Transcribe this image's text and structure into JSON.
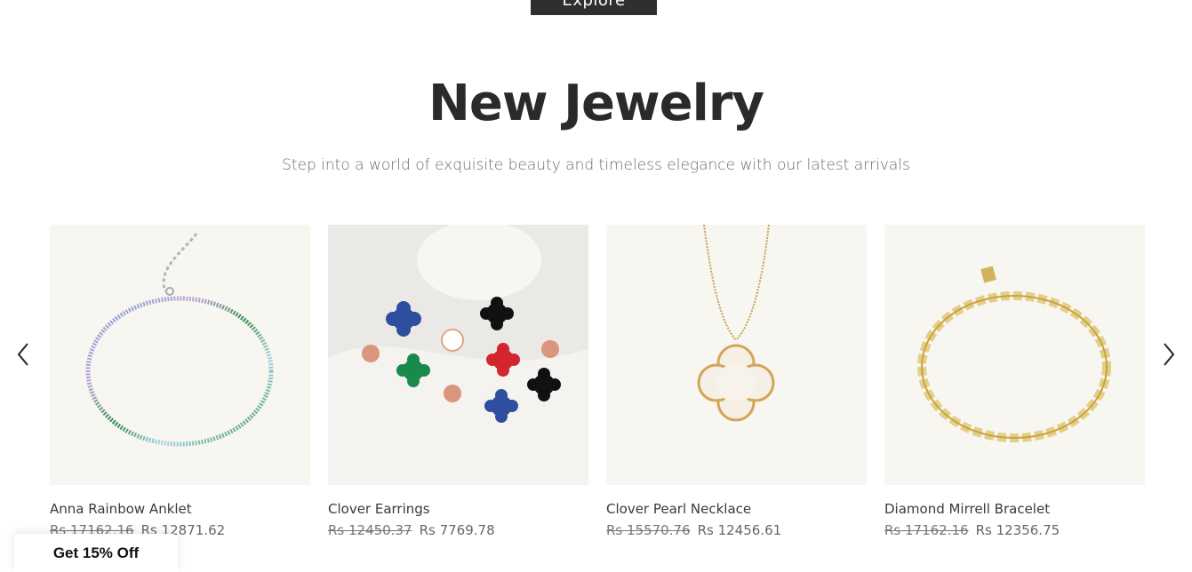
{
  "hero": {
    "explore_label": "Explore"
  },
  "section": {
    "title": "New Jewelry",
    "subtitle": "Step into a world of exquisite beauty and timeless elegance with our latest arrivals"
  },
  "carousel": {
    "prev_icon": "chevron-left-icon",
    "next_icon": "chevron-right-icon",
    "products": [
      {
        "name": "Anna Rainbow Anklet",
        "old_price": "Rs 17162.16",
        "new_price": "Rs 12871.62"
      },
      {
        "name": "Clover Earrings",
        "old_price": "Rs 12450.37",
        "new_price": "Rs 7769.78"
      },
      {
        "name": "Clover Pearl Necklace",
        "old_price": "Rs 15570.76",
        "new_price": "Rs 12456.61"
      },
      {
        "name": "Diamond Mirrell Bracelet",
        "old_price": "Rs 17162.16",
        "new_price": "Rs 12356.75"
      }
    ]
  },
  "promo": {
    "label": "Get 15% Off"
  },
  "colors": {
    "button_bg": "#2f2f2f",
    "title": "#2a2a2a",
    "card_bg": "#f8f6f1"
  }
}
